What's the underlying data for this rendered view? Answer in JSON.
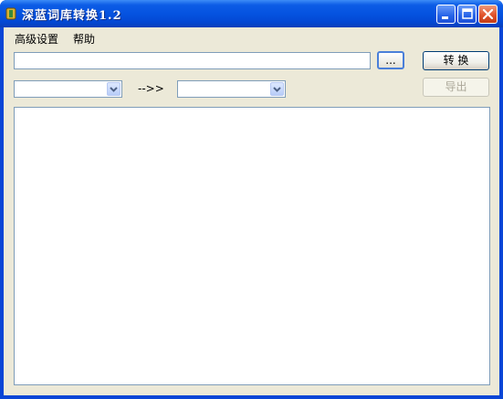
{
  "window": {
    "title": "深蓝词库转换1.2"
  },
  "titlebar_buttons": {
    "minimize_icon": "minimize-icon",
    "maximize_icon": "maximize-icon",
    "close_icon": "close-icon"
  },
  "menu": {
    "items": [
      {
        "label": "高级设置"
      },
      {
        "label": "帮助"
      }
    ]
  },
  "file_path": {
    "value": "",
    "browse_label": "..."
  },
  "convert_button": {
    "label": "转 换"
  },
  "from_format": {
    "selected": ""
  },
  "arrow_label": "-->>",
  "to_format": {
    "selected": ""
  },
  "export_button": {
    "label": "导出"
  },
  "output": {
    "text": ""
  },
  "colors": {
    "titlebar": "#0553e0",
    "frame": "#0a46d6",
    "client_bg": "#ece9d8",
    "field_border": "#7f9db9",
    "close_button": "#e2532b"
  }
}
